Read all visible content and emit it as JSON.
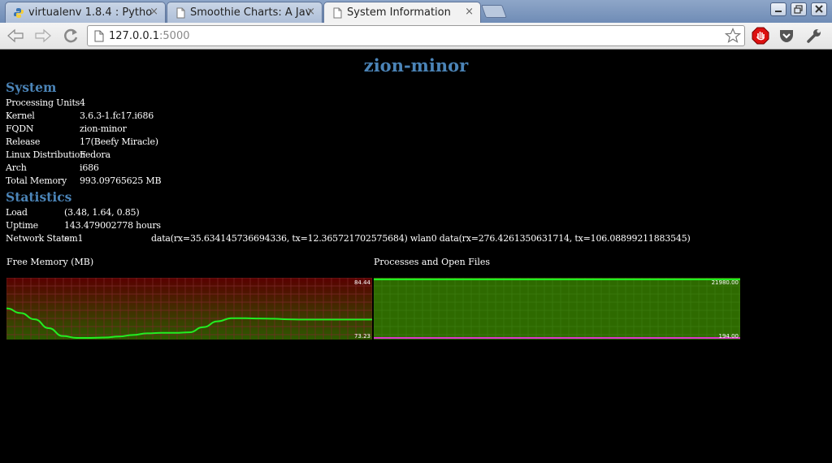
{
  "browser": {
    "tabs": [
      {
        "label": "virtualenv 1.8.4 : Pytho",
        "icon": "python-icon",
        "active": false
      },
      {
        "label": "Smoothie Charts: A Jav",
        "icon": "page-icon",
        "active": false
      },
      {
        "label": "System Information",
        "icon": "page-icon",
        "active": true
      }
    ],
    "url_host": "127.0.0.1",
    "url_port": ":5000",
    "close_glyph": "×"
  },
  "page": {
    "title": "zion-minor",
    "system": {
      "heading": "System",
      "rows": [
        {
          "label": "Processing Units",
          "value": "4"
        },
        {
          "label": "Kernel",
          "value": "3.6.3-1.fc17.i686"
        },
        {
          "label": "FQDN",
          "value": "zion-minor"
        },
        {
          "label": "Release",
          "value": "17(Beefy Miracle)"
        },
        {
          "label": "Linux Distribution",
          "value": "Fedora"
        },
        {
          "label": "Arch",
          "value": "i686"
        },
        {
          "label": "Total Memory",
          "value": "993.09765625 MB"
        }
      ]
    },
    "statistics": {
      "heading": "Statistics",
      "rows": [
        {
          "label": "Load",
          "value": "(3.48, 1.64, 0.85)"
        },
        {
          "label": "Uptime",
          "value": "143.479002778 hours"
        },
        {
          "label": "Network Stats",
          "value": "em1",
          "detail": "data(rx=35.634145736694336, tx=12.365721702575684) wlan0 data(rx=276.4261350631714, tx=106.08899211883545)"
        }
      ]
    }
  },
  "chart_data": [
    {
      "type": "line",
      "title": "Free Memory (MB)",
      "max_label": "84.44",
      "min_label": "73.23",
      "ylim": [
        73.23,
        84.44
      ],
      "series": [
        {
          "values": [
            78.9,
            78.0,
            76.8,
            75.1,
            73.6,
            73.23,
            73.23,
            73.3,
            73.5,
            73.8,
            74.1,
            74.2,
            74.2,
            74.3,
            75.3,
            76.4,
            77.0,
            77.0,
            76.95,
            76.9,
            76.8,
            76.75,
            76.75,
            76.75,
            76.75,
            76.75,
            76.75
          ],
          "color": "#22ee22"
        }
      ],
      "colors": {
        "background_top": "#5a0000",
        "background_bottom": "#2c5a00",
        "grid": "#7a2a2a"
      }
    },
    {
      "type": "line",
      "title": "Processes and Open Files",
      "max_label": "21980.00",
      "min_label": "194.00",
      "ylim": [
        194,
        21980
      ],
      "series": [
        {
          "values": [
            21980,
            21980,
            21980,
            21980,
            21980,
            21980,
            21980,
            21980,
            21980,
            21980
          ],
          "color": "#22ee22"
        },
        {
          "values": [
            194,
            194,
            194,
            194,
            194,
            194,
            194,
            194,
            194,
            194
          ],
          "color": "#dd33cc"
        }
      ],
      "colors": {
        "background": "#2e6a00",
        "grid": "#3d7d10"
      }
    }
  ]
}
